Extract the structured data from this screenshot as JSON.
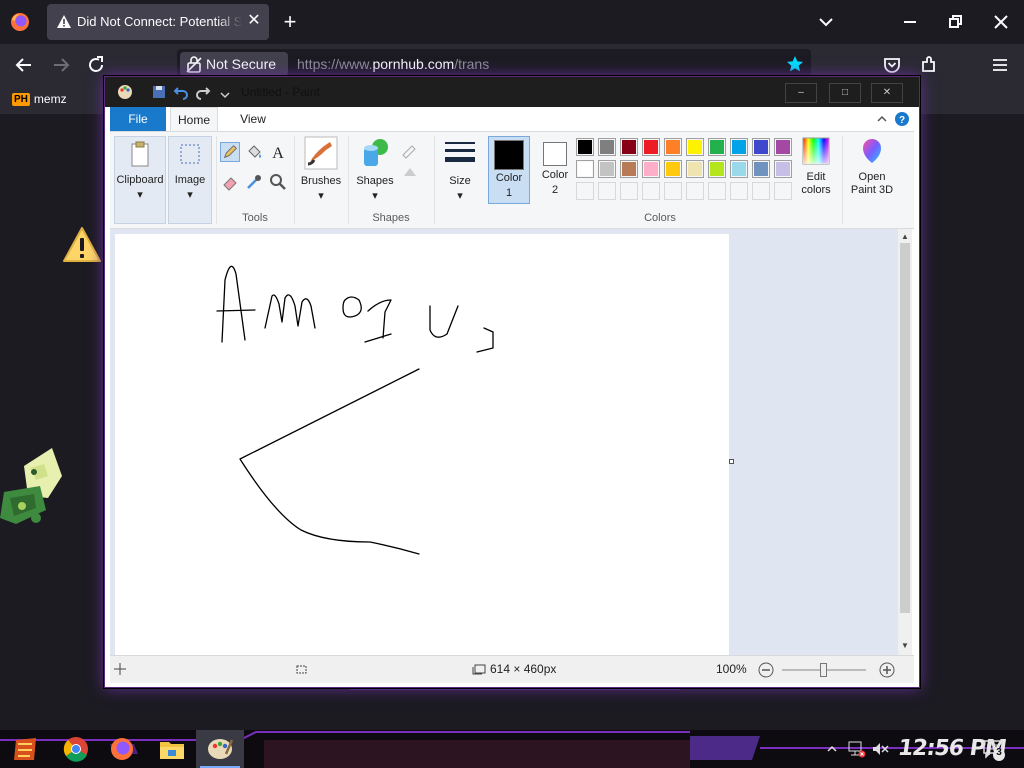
{
  "browser": {
    "tab_title": "Did Not Connect: Potential Security Issue",
    "new_tab_symbol": "+",
    "close_tab_symbol": "✕",
    "security_label": "Not Secure",
    "url_scheme": "https://www.",
    "url_host": "pornhub.com",
    "url_path": "/trans",
    "bookmarks": [
      {
        "label": "memz",
        "favicon_text": "PH"
      }
    ]
  },
  "paint": {
    "title": "Untitled - Paint",
    "tabs": {
      "file": "File",
      "home": "Home",
      "view": "View"
    },
    "groups": {
      "clipboard": "Clipboard",
      "image": "Image",
      "tools": "Tools",
      "brushes": "Brushes",
      "shapes": "Shapes",
      "shapes_group": "Shapes",
      "size": "Size",
      "color1": "Color",
      "color1_num": "1",
      "color2": "Color",
      "color2_num": "2",
      "colors": "Colors",
      "edit_colors_1": "Edit",
      "edit_colors_2": "colors",
      "open_3d_1": "Open",
      "open_3d_2": "Paint 3D"
    },
    "palette_row1": [
      "#000000",
      "#7f7f7f",
      "#880015",
      "#ed1c24",
      "#ff7f27",
      "#fff200",
      "#22b14c",
      "#00a2e8",
      "#3f48cc",
      "#a349a4"
    ],
    "palette_row2": [
      "#ffffff",
      "#c3c3c3",
      "#b97a57",
      "#ffaec9",
      "#ffc90e",
      "#efe4b0",
      "#b5e61d",
      "#99d9ea",
      "#7092be",
      "#c8bfe7"
    ],
    "color1": "#000000",
    "color2": "#ffffff",
    "canvas_size": "614 × 460px",
    "zoom": "100%",
    "zoom_level": 1.0
  },
  "taskbar": {
    "time": "12:56 PM",
    "notification_count": "3"
  },
  "colors": {
    "accent_purple": "#7b2fbe",
    "firefox_bg": "#1c1b22",
    "paint_blue": "#1979ca"
  }
}
